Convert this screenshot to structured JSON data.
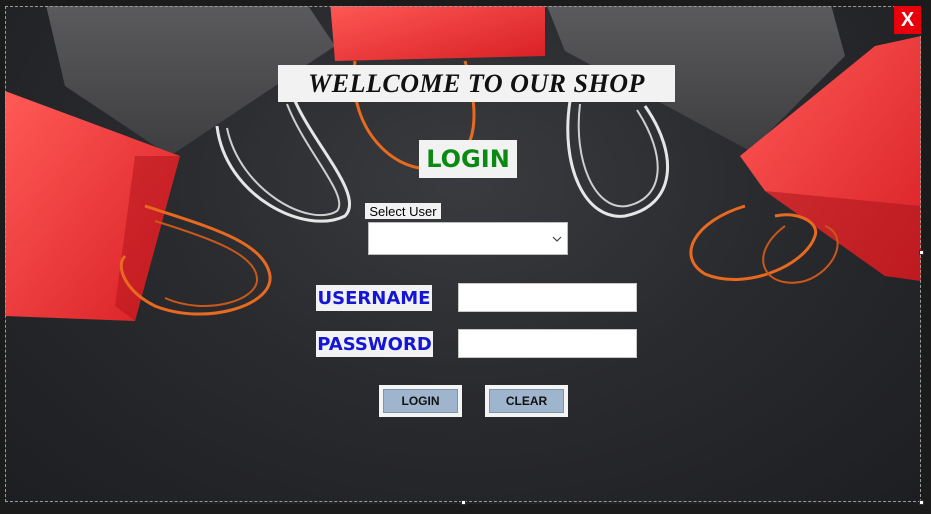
{
  "window": {
    "close_label": "X"
  },
  "header": {
    "welcome_text": "WELLCOME TO OUR SHOP",
    "login_title": "LOGIN"
  },
  "form": {
    "select_user_label": "Select User",
    "select_user_value": "",
    "username_label": "USERNAME",
    "username_value": "",
    "password_label": "PASSWORD",
    "password_value": "",
    "login_button": "LOGIN",
    "clear_button": "CLEAR"
  },
  "icons": {
    "close": "close-icon",
    "dropdown": "chevron-down-icon"
  },
  "colors": {
    "close_bg": "#e8000b",
    "login_title": "#0a8a12",
    "field_label": "#1515d6",
    "button_face": "#9fb4cd"
  }
}
